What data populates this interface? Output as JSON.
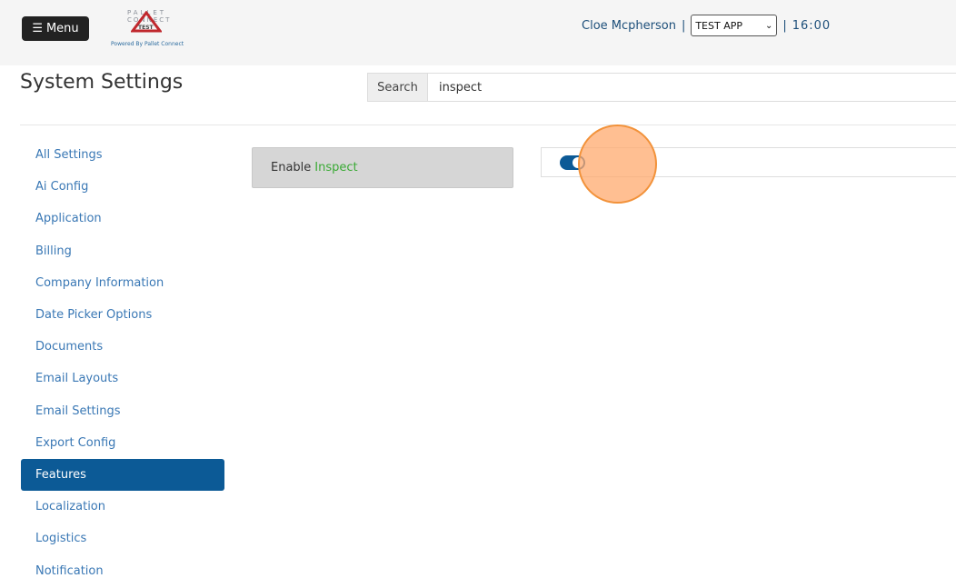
{
  "header": {
    "menu_label": "Menu",
    "logo": {
      "top_text": "PALLET",
      "mid_text": "CONNECT",
      "badge_text": "TEST",
      "powered_by": "Powered By Pallet Connect"
    },
    "user_name": "Cloe Mcpherson",
    "separator": "|",
    "app_select": {
      "selected": "TEST APP"
    },
    "clock": "16:00"
  },
  "page": {
    "title": "System Settings",
    "search": {
      "label": "Search",
      "value": "inspect"
    }
  },
  "sidebar": {
    "items": [
      {
        "label": "All Settings",
        "active": false
      },
      {
        "label": "Ai Config",
        "active": false
      },
      {
        "label": "Application",
        "active": false
      },
      {
        "label": "Billing",
        "active": false
      },
      {
        "label": "Company Information",
        "active": false
      },
      {
        "label": "Date Picker Options",
        "active": false
      },
      {
        "label": "Documents",
        "active": false
      },
      {
        "label": "Email Layouts",
        "active": false
      },
      {
        "label": "Email Settings",
        "active": false
      },
      {
        "label": "Export Config",
        "active": false
      },
      {
        "label": "Features",
        "active": true
      },
      {
        "label": "Localization",
        "active": false
      },
      {
        "label": "Logistics",
        "active": false
      },
      {
        "label": "Notification",
        "active": false
      }
    ]
  },
  "setting": {
    "label_prefix": "Enable",
    "label_highlight": "Inspect",
    "enabled": true
  },
  "colors": {
    "accent": "#0c5a96",
    "highlight": "#3aaa35",
    "link": "#3a78b5"
  }
}
